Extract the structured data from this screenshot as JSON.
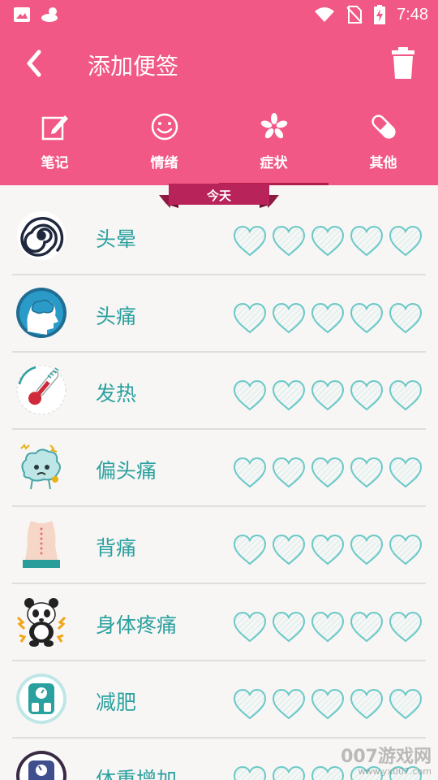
{
  "status_bar": {
    "time": "7:48"
  },
  "toolbar": {
    "title": "添加便签"
  },
  "tabs": [
    {
      "label": "笔记",
      "icon": "note-edit-icon"
    },
    {
      "label": "情绪",
      "icon": "smiley-icon"
    },
    {
      "label": "症状",
      "icon": "flower-icon",
      "selected": true
    },
    {
      "label": "其他",
      "icon": "pill-icon"
    }
  ],
  "ribbon": {
    "label": "今天"
  },
  "symptoms": [
    {
      "label": "头晕",
      "icon": "dizzy-spiral-icon",
      "rating": 0,
      "max": 5
    },
    {
      "label": "头痛",
      "icon": "headache-brain-icon",
      "rating": 0,
      "max": 5
    },
    {
      "label": "发热",
      "icon": "thermometer-icon",
      "rating": 0,
      "max": 5
    },
    {
      "label": "偏头痛",
      "icon": "migraine-brain-icon",
      "rating": 0,
      "max": 5
    },
    {
      "label": "背痛",
      "icon": "back-pain-icon",
      "rating": 0,
      "max": 5
    },
    {
      "label": "身体疼痛",
      "icon": "panda-pain-icon",
      "rating": 0,
      "max": 5
    },
    {
      "label": "减肥",
      "icon": "scale-loss-icon",
      "rating": 0,
      "max": 5
    },
    {
      "label": "体重增加",
      "icon": "scale-gain-icon",
      "rating": 0,
      "max": 5
    }
  ],
  "watermark": {
    "line1": "007游戏网",
    "line2": "www.yx007.com"
  },
  "colors": {
    "header": "#f25886",
    "accent_text": "#2ba19f",
    "heart_stroke": "#6cc9c8",
    "ribbon": "#b8245a"
  }
}
